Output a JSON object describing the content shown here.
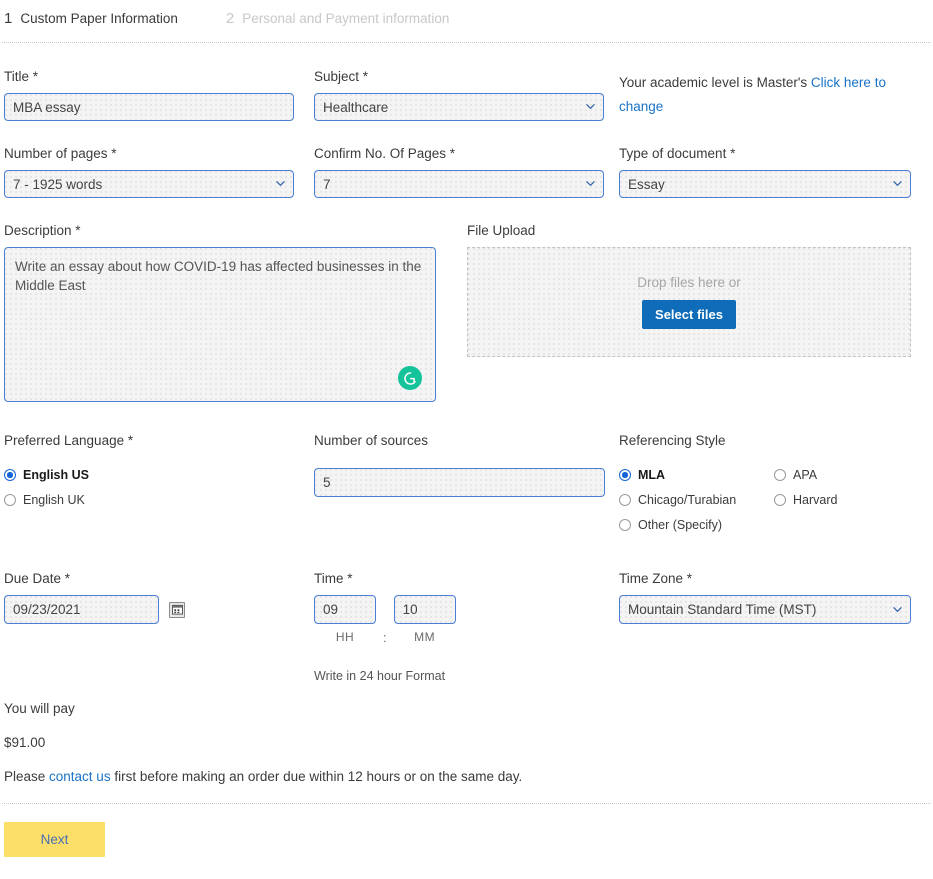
{
  "steps": [
    {
      "num": "1",
      "label": "Custom Paper Information",
      "active": true
    },
    {
      "num": "2",
      "label": "Personal and Payment information",
      "active": false
    }
  ],
  "academic": {
    "prefix": "Your academic level is Master's",
    "link": "Click here to change"
  },
  "fields": {
    "title": {
      "label": "Title *",
      "value": "MBA essay"
    },
    "subject": {
      "label": "Subject *",
      "value": "Healthcare"
    },
    "pages": {
      "label": "Number of pages *",
      "value": "7 - 1925 words"
    },
    "confirm_pages": {
      "label": "Confirm No. Of Pages *",
      "value": "7"
    },
    "doc_type": {
      "label": "Type of document *",
      "value": "Essay"
    },
    "description": {
      "label": "Description *",
      "value": "Write an essay about how COVID-19 has affected businesses in the Middle East"
    },
    "file_upload": {
      "label": "File Upload",
      "drop_text": "Drop files here or",
      "button": "Select files"
    },
    "language": {
      "label": "Preferred Language *",
      "options": [
        {
          "label": "English US",
          "selected": true
        },
        {
          "label": "English UK",
          "selected": false
        }
      ]
    },
    "sources": {
      "label": "Number of sources",
      "value": "5"
    },
    "referencing": {
      "label": "Referencing Style",
      "options": [
        {
          "label": "MLA",
          "selected": true
        },
        {
          "label": "APA",
          "selected": false
        },
        {
          "label": "Chicago/Turabian",
          "selected": false
        },
        {
          "label": "Harvard",
          "selected": false
        },
        {
          "label": "Other (Specify)",
          "selected": false
        }
      ]
    },
    "due_date": {
      "label": "Due Date *",
      "value": "09/23/2021"
    },
    "time": {
      "label": "Time *",
      "hours": "09",
      "minutes": "10",
      "hh_label": "HH",
      "mm_label": "MM",
      "separator": ":",
      "hint": "Write in 24 hour Format"
    },
    "timezone": {
      "label": "Time Zone *",
      "value": "Mountain Standard Time (MST)"
    }
  },
  "summary": {
    "pay_label": "You will pay",
    "amount": "$91.00",
    "notice_before": "Please ",
    "notice_link": "contact us",
    "notice_after": " first before making an order due within 12 hours or on the same day.",
    "next_button": "Next"
  },
  "colors": {
    "accent_blue": "#0e6cb8",
    "link_blue": "#1a73c8",
    "radio_blue": "#1565d8",
    "next_yellow": "#fbdf68",
    "next_text": "#4a6fb5",
    "grammarly_green": "#15c39a",
    "input_border": "#4b7fd6"
  }
}
